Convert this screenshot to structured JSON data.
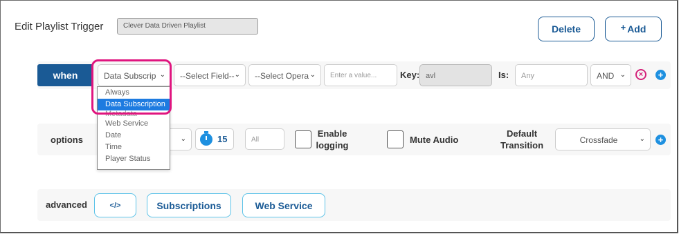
{
  "header": {
    "title": "Edit Playlist Trigger",
    "playlist_name": "Clever Data Driven Playlist",
    "delete_label": "Delete",
    "add_label": "Add",
    "add_plus": "+"
  },
  "when_row": {
    "badge": "when",
    "source_select": "Data Subscrip",
    "field_select": "--Select Field--",
    "operator_select": "--Select Opera",
    "value_placeholder": "Enter a value...",
    "key_label": "Key:",
    "key_value": "avl",
    "is_label": "Is:",
    "is_placeholder": "Any",
    "conjunction": "AND",
    "remove_glyph": "×",
    "add_glyph": "+"
  },
  "source_dropdown": {
    "options": [
      "Always",
      "Data Subscription",
      "Metadata",
      "Web Service",
      "Date",
      "Time",
      "Player Status"
    ],
    "selected": "Data Subscription"
  },
  "options_row": {
    "label": "options",
    "duration": "15",
    "all_placeholder": "All",
    "enable_logging_label": "Enable logging",
    "mute_audio_label": "Mute Audio",
    "default_transition_label": "Default Transition",
    "transition_value": "Crossfade",
    "add_glyph": "+"
  },
  "advanced_row": {
    "label": "advanced",
    "code_glyph": "</>",
    "subscriptions_label": "Subscriptions",
    "web_service_label": "Web Service"
  },
  "colors": {
    "primary": "#1a5a95",
    "accent_blue": "#1e90e0",
    "highlight_pink": "#e0157f",
    "selected_option": "#1e7be0"
  }
}
